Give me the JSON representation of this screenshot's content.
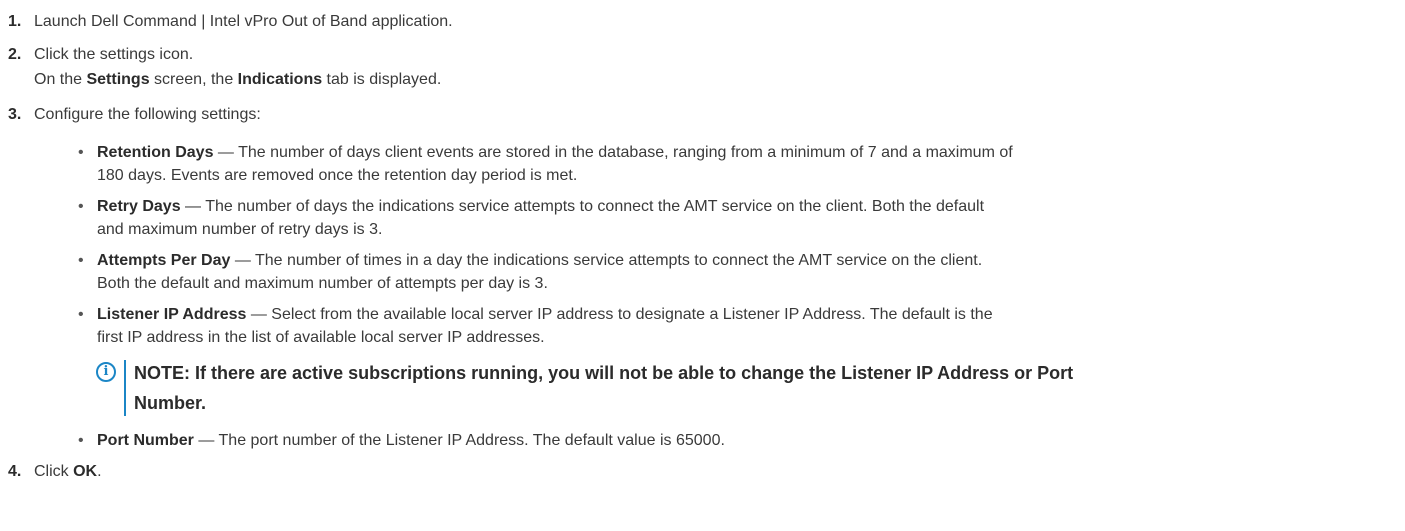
{
  "steps": [
    {
      "number": "1.",
      "text": "Launch Dell Command | Intel vPro Out of Band application."
    },
    {
      "number": "2.",
      "text": "Click the settings icon.",
      "sub_pre": "On the ",
      "sub_b1": "Settings",
      "sub_mid": " screen, the ",
      "sub_b2": "Indications",
      "sub_post": " tab is displayed."
    },
    {
      "number": "3.",
      "text": "Configure the following settings:"
    },
    {
      "number": "4.",
      "pre": "Click ",
      "bold": "OK",
      "post": "."
    }
  ],
  "bullets": [
    {
      "title": "Retention Days",
      "dash": " — ",
      "line1": "The number of days client events are stored in the database, ranging from a minimum of 7 and a maximum of",
      "line2": "180 days. Events are removed once the retention day period is met."
    },
    {
      "title": "Retry Days",
      "dash": " — ",
      "line1": "The number of days the indications service attempts to connect the AMT service on the client. Both the default",
      "line2": "and maximum number of retry days is 3."
    },
    {
      "title": "Attempts Per Day",
      "dash": " — ",
      "line1": "The number of times in a day the indications service attempts to connect the AMT service on the client.",
      "line2": "Both the default and maximum number of attempts per day is 3."
    },
    {
      "title": "Listener IP Address",
      "dash": " — ",
      "line1": "Select from the available local server IP address to designate a Listener IP Address. The default is the",
      "line2": "first IP address in the list of available local server IP addresses."
    },
    {
      "title": "Port Number",
      "dash": " — ",
      "line1": "The port number of the Listener IP Address. The default value is 65000."
    }
  ],
  "note": {
    "icon": "info-icon",
    "line1": "NOTE: If there are active subscriptions running, you will not be able to change the Listener IP Address or Port",
    "line2": "Number."
  },
  "bullet_char": "•",
  "colors": {
    "accent": "#1b86c6",
    "text": "#3a3a3a"
  }
}
